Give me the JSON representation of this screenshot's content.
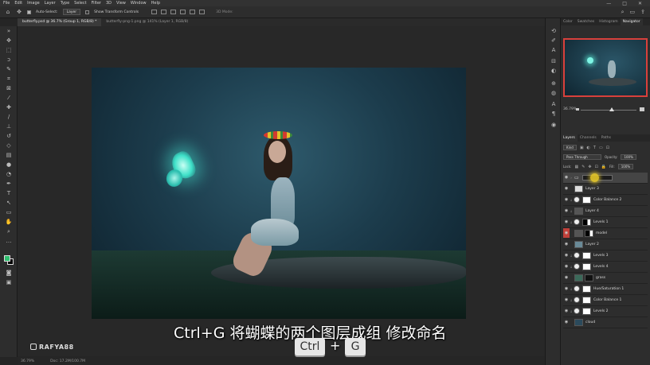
{
  "menu": [
    "File",
    "Edit",
    "Image",
    "Layer",
    "Type",
    "Select",
    "Filter",
    "3D",
    "View",
    "Window",
    "Help"
  ],
  "window_controls": [
    "—",
    "□",
    "✕"
  ],
  "options": {
    "auto_select_label": "Auto-Select:",
    "auto_select_value": "Layer",
    "transform_controls_label": "Show Transform Controls",
    "mode_3d_label": "3D Mode:"
  },
  "tabs": [
    {
      "label": "butterfly.psd @ 36.7% (Group 1, RGB/8) *",
      "active": true
    },
    {
      "label": "butterfly-png-1.png @ 141% (Layer 1, RGB/8)",
      "active": false
    }
  ],
  "status": {
    "zoom": "36.79%",
    "doc": "Doc: 17.2M/100.7M"
  },
  "subtitle": "Ctrl+G 将蝴蝶的两个图层成组 修改命名",
  "keys": [
    "Ctrl",
    "+",
    "G"
  ],
  "watermark": "RAFYA88",
  "panels": {
    "top_tabs": [
      "Color",
      "Swatches",
      "Histogram",
      "Navigator"
    ],
    "active_top_tab": "Navigator",
    "nav_zoom": "36.79%",
    "layer_tabs": [
      "Layers",
      "Channels",
      "Paths"
    ],
    "kind_label": "Kind",
    "blend_mode": "Pass Through",
    "opacity_label": "Opacity:",
    "opacity_value": "100%",
    "lock_label": "Lock:",
    "fill_label": "Fill:",
    "fill_value": "100%",
    "layers": [
      {
        "name": "",
        "type": "group",
        "selected": true,
        "renaming": true
      },
      {
        "name": "Layer 3",
        "type": "pixel"
      },
      {
        "name": "Color Balance 2",
        "type": "adjustment"
      },
      {
        "name": "Layer 4",
        "type": "pixel"
      },
      {
        "name": "Levels 1",
        "type": "adjustment"
      },
      {
        "name": "model",
        "type": "pixel",
        "eye_red": true
      },
      {
        "name": "Layer 2",
        "type": "pixel"
      },
      {
        "name": "Levels 3",
        "type": "adjustment"
      },
      {
        "name": "Levels 4",
        "type": "adjustment"
      },
      {
        "name": "grass",
        "type": "pixel"
      },
      {
        "name": "Hue/Saturation 1",
        "type": "adjustment"
      },
      {
        "name": "Color Balance 1",
        "type": "adjustment"
      },
      {
        "name": "Levels 2",
        "type": "adjustment"
      },
      {
        "name": "cloud",
        "type": "pixel"
      }
    ]
  },
  "colors": {
    "foreground": "#2fbf6f",
    "background": "#000000",
    "accent_red": "#d8403b"
  }
}
